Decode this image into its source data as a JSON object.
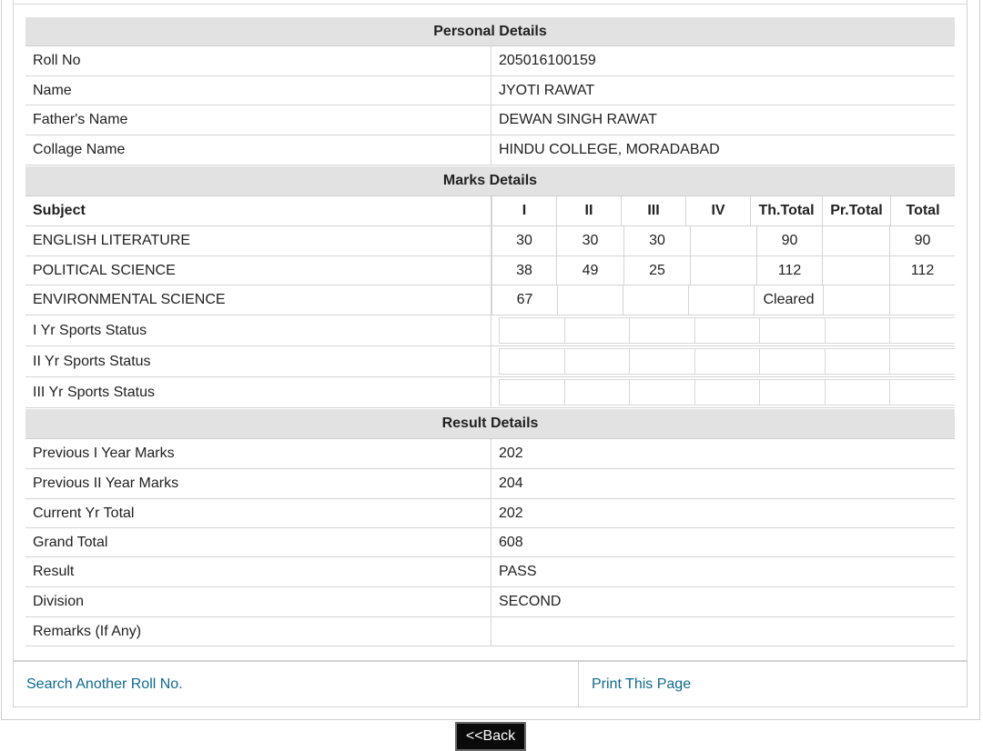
{
  "personal": {
    "title": "Personal Details",
    "rows": [
      {
        "label": "Roll No",
        "value": "205016100159"
      },
      {
        "label": "Name",
        "value": "JYOTI RAWAT"
      },
      {
        "label": "Father's Name",
        "value": "DEWAN SINGH RAWAT"
      },
      {
        "label": "Collage Name",
        "value": "HINDU COLLEGE, MORADABAD"
      }
    ]
  },
  "marks": {
    "title": "Marks Details",
    "headers": [
      "Subject",
      "I",
      "II",
      "III",
      "IV",
      "Th.Total",
      "Pr.Total",
      "Total"
    ],
    "subjects": [
      {
        "name": "ENGLISH LITERATURE",
        "cells": [
          "30",
          "30",
          "30",
          "",
          "90",
          "",
          "90"
        ]
      },
      {
        "name": "POLITICAL SCIENCE",
        "cells": [
          "38",
          "49",
          "25",
          "",
          "112",
          "",
          "112"
        ]
      },
      {
        "name": "ENVIRONMENTAL SCIENCE",
        "cells": [
          "67",
          "",
          "",
          "",
          "Cleared",
          "",
          ""
        ]
      }
    ],
    "sports": [
      {
        "label": "I Yr Sports Status"
      },
      {
        "label": "II Yr Sports Status"
      },
      {
        "label": "III Yr Sports Status"
      }
    ]
  },
  "result": {
    "title": "Result Details",
    "rows": [
      {
        "label": "Previous I Year Marks",
        "value": "202"
      },
      {
        "label": "Previous II Year Marks",
        "value": "204"
      },
      {
        "label": "Current Yr Total",
        "value": "202"
      },
      {
        "label": "Grand Total",
        "value": "608"
      },
      {
        "label": "Result",
        "value": "PASS"
      },
      {
        "label": "Division",
        "value": "SECOND"
      },
      {
        "label": "Remarks (If Any)",
        "value": ""
      }
    ]
  },
  "links": {
    "search_another": "Search Another Roll No.",
    "print_page": "Print This Page"
  },
  "back_label": "<<Back",
  "colors": {
    "link": "#0d6a8f",
    "section_bg": "#e2e2e2",
    "button_bg": "#0a0a0a"
  }
}
